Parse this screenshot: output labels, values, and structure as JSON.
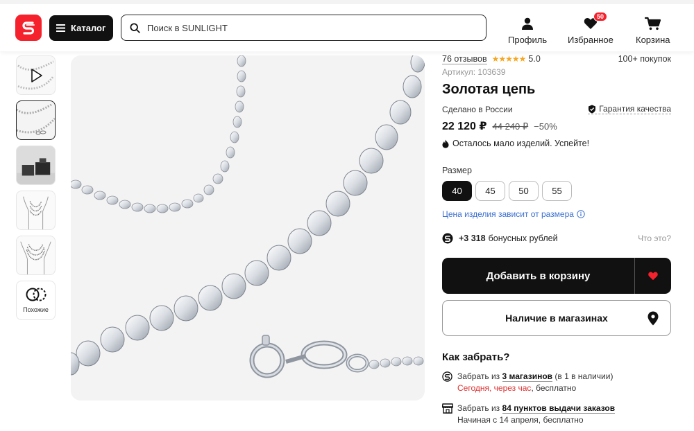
{
  "header": {
    "catalog_label": "Каталог",
    "search_placeholder": "Поиск в SUNLIGHT",
    "profile_label": "Профиль",
    "favorites_label": "Избранное",
    "favorites_count": "50",
    "cart_label": "Корзина"
  },
  "gallery": {
    "similar_label": "Похожие"
  },
  "product": {
    "reviews": "76 отзывов",
    "stars": "★★★★★",
    "rating": "5.0",
    "purchases": "100+ покупок",
    "article": "Артикул: 103639",
    "title": "Золотая цепь",
    "made_in": "Сделано в России",
    "guarantee": "Гарантия качества",
    "price": "22 120 ₽",
    "old_price": "44 240 ₽",
    "discount": "−50%",
    "stock_note": "Осталось мало изделий. Успейте!",
    "size_label": "Размер",
    "sizes": [
      "40",
      "45",
      "50",
      "55"
    ],
    "selected_size": "40",
    "size_note": "Цена изделия зависит от размера",
    "bonus_amount": "+3 318",
    "bonus_text": "бонусных рублей",
    "bonus_whats": "Что это?",
    "add_to_cart": "Добавить в корзину",
    "in_stores": "Наличие в магазинах"
  },
  "pickup": {
    "heading": "Как забрать?",
    "stores_prefix": "Забрать из",
    "stores_count": "3 магазинов",
    "stores_suffix": "(в 1 в наличии)",
    "stores_when": "Сегодня, через час",
    "stores_cost": ", бесплатно",
    "points_prefix": "Забрать из",
    "points_count": "84 пунктов выдачи заказов",
    "points_when": "Начиная с 14 апреля, бесплатно"
  },
  "colors": {
    "brand_red": "#f5222d",
    "primary_black": "#111111",
    "star": "#f5a623",
    "link_blue": "#3a6fd0",
    "alert_red": "#e03030"
  },
  "icons": {
    "logo": "sunlight-logo-icon",
    "catalog": "hamburger-icon",
    "search": "search-icon",
    "profile": "user-icon",
    "favorites": "heart-icon",
    "cart": "cart-icon",
    "guarantee": "shield-check-icon",
    "stock": "flame-icon",
    "info": "info-icon",
    "bonus": "sunlight-bonus-icon",
    "fav_button": "heart-filled-icon",
    "stores": "map-pin-icon",
    "pickup_store": "store-logo-icon",
    "pickup_points": "shop-icon",
    "video": "play-icon",
    "similar": "similar-icon"
  }
}
